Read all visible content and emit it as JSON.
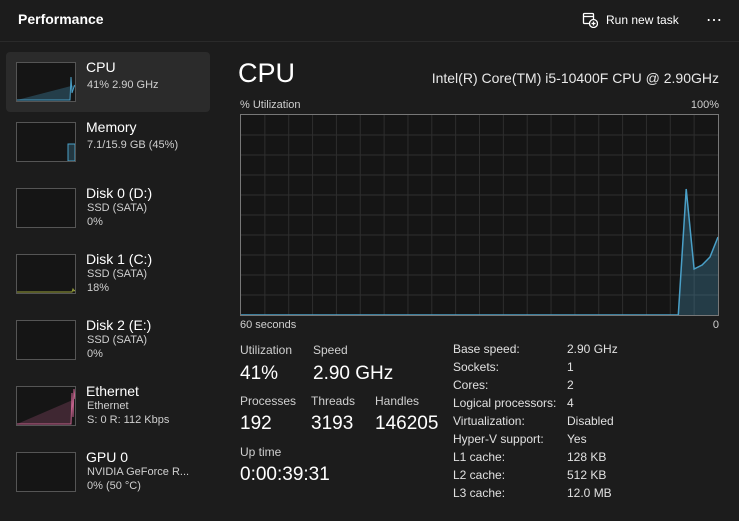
{
  "header": {
    "title": "Performance",
    "run_task_label": "Run new task",
    "more_label": "⋯"
  },
  "colors": {
    "cpu_line": "#4aa0c8",
    "ethernet_line": "#c0608a",
    "disk_line": "#9aa43a",
    "background": "#1c1c1c",
    "selected": "#2b2b2b"
  },
  "sidebar": {
    "items": [
      {
        "name": "CPU",
        "sub1": "41%  2.90 GHz",
        "sub2": ""
      },
      {
        "name": "Memory",
        "sub1": "7.1/15.9 GB (45%)",
        "sub2": ""
      },
      {
        "name": "Disk 0 (D:)",
        "sub1": "SSD (SATA)",
        "sub2": "0%"
      },
      {
        "name": "Disk 1 (C:)",
        "sub1": "SSD (SATA)",
        "sub2": "18%"
      },
      {
        "name": "Disk 2 (E:)",
        "sub1": "SSD (SATA)",
        "sub2": "0%"
      },
      {
        "name": "Ethernet",
        "sub1": "Ethernet",
        "sub2": "S: 0  R: 112 Kbps"
      },
      {
        "name": "GPU 0",
        "sub1": "NVIDIA GeForce R...",
        "sub2": "0%  (50 °C)"
      }
    ]
  },
  "main": {
    "title": "CPU",
    "model": "Intel(R) Core(TM) i5-10400F CPU @ 2.90GHz",
    "util_label": "% Utilization",
    "max_label": "100%",
    "time_left": "60 seconds",
    "time_right": "0"
  },
  "chart_data": {
    "type": "area",
    "title": "",
    "ylabel": "% Utilization",
    "xlabel": "",
    "xlim": [
      60,
      0
    ],
    "ylim": [
      0,
      100
    ],
    "grid": true,
    "series": [
      {
        "x": [
          60,
          5,
          4,
          3,
          2,
          1,
          0
        ],
        "values": [
          0,
          0,
          63,
          23,
          25,
          29,
          39
        ]
      }
    ]
  },
  "stats": {
    "utilization_label": "Utilization",
    "utilization_value": "41%",
    "speed_label": "Speed",
    "speed_value": "2.90 GHz",
    "processes_label": "Processes",
    "processes_value": "192",
    "threads_label": "Threads",
    "threads_value": "3193",
    "handles_label": "Handles",
    "handles_value": "146205",
    "uptime_label": "Up time",
    "uptime_value": "0:00:39:31"
  },
  "specs": [
    {
      "key": "Base speed:",
      "value": "2.90 GHz"
    },
    {
      "key": "Sockets:",
      "value": "1"
    },
    {
      "key": "Cores:",
      "value": "2"
    },
    {
      "key": "Logical processors:",
      "value": "4"
    },
    {
      "key": "Virtualization:",
      "value": "Disabled"
    },
    {
      "key": "Hyper-V support:",
      "value": "Yes"
    },
    {
      "key": "L1 cache:",
      "value": "128 KB"
    },
    {
      "key": "L2 cache:",
      "value": "512 KB"
    },
    {
      "key": "L3 cache:",
      "value": "12.0 MB"
    }
  ]
}
